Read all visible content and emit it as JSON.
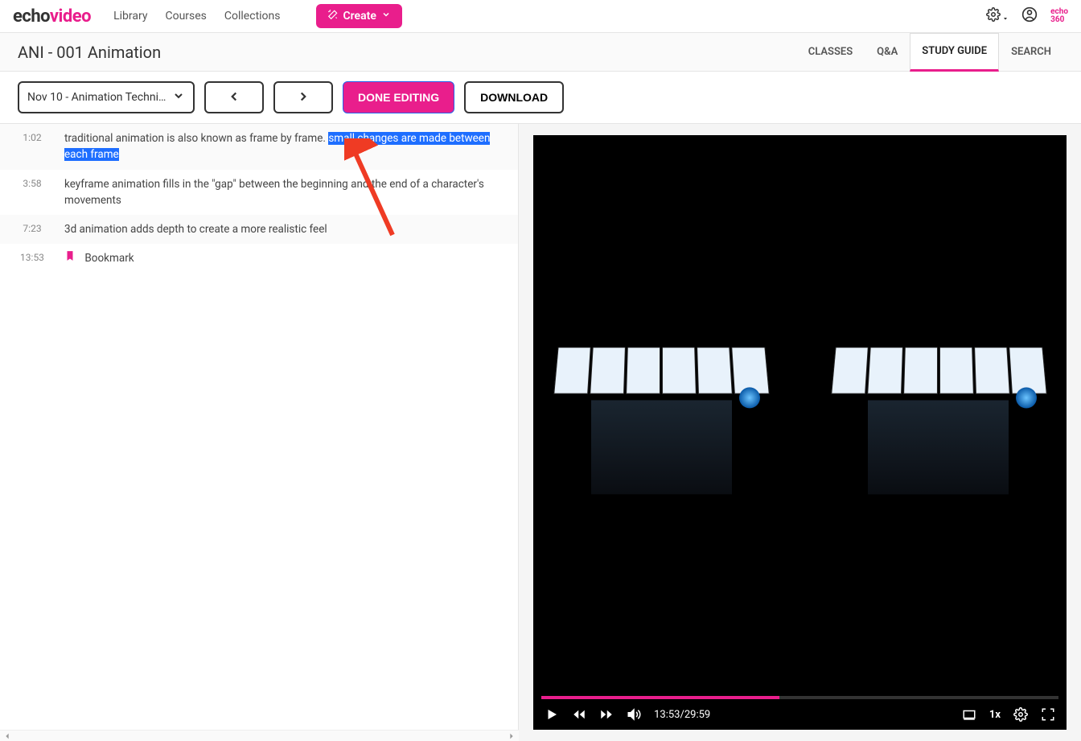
{
  "brand": {
    "part1": "echo",
    "part2": "video"
  },
  "nav": {
    "library": "Library",
    "courses": "Courses",
    "collections": "Collections",
    "create": "Create"
  },
  "corner_brand": {
    "l1": "echo",
    "l2": "360"
  },
  "course_title": "ANI - 001 Animation",
  "tabs": {
    "classes": "CLASSES",
    "qa": "Q&A",
    "study_guide": "STUDY GUIDE",
    "search": "SEARCH"
  },
  "toolbar": {
    "session_label": "Nov 10 - Animation Techniqu...",
    "done": "DONE EDITING",
    "download": "DOWNLOAD"
  },
  "notes": [
    {
      "time": "1:02",
      "text_pre": "traditional animation is also known as frame by frame. ",
      "text_hl": "small changes are made between each frame"
    },
    {
      "time": "3:58",
      "text": "keyframe animation fills in the \"gap\" between the beginning and the end of a character's movements"
    },
    {
      "time": "7:23",
      "text": "3d animation adds depth to create a more realistic feel"
    },
    {
      "time": "13:53",
      "bookmark": "Bookmark"
    }
  ],
  "player": {
    "time_display": "13:53/29:59",
    "speed": "1x"
  }
}
